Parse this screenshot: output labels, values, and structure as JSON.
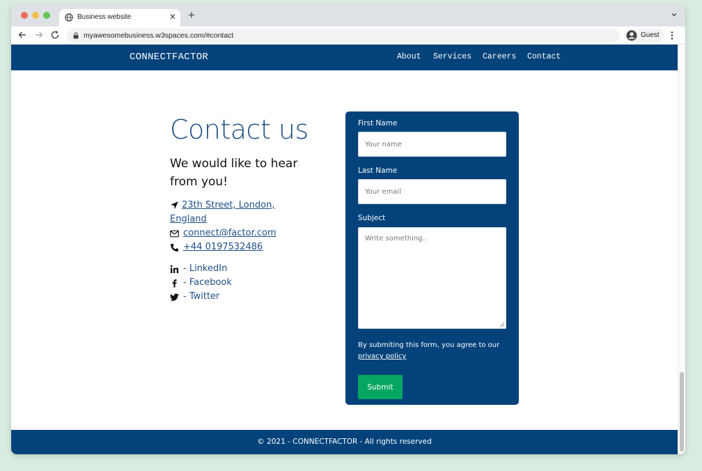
{
  "browser": {
    "tab_title": "Business website",
    "url": "myawesomebusiness.w3spaces.com/#contact",
    "profile_label": "Guest"
  },
  "navbar": {
    "brand": "CONNECTFACTOR",
    "links": [
      "About",
      "Services",
      "Careers",
      "Contact"
    ]
  },
  "contact": {
    "title": "Contact us",
    "subtitle": "We would like to hear from you!",
    "address": "23th Street, London, England",
    "email": "connect@factor.com",
    "phone": "+44 0197532486",
    "socials": [
      "- LinkedIn",
      "- Facebook",
      "- Twitter"
    ]
  },
  "form": {
    "first_name_label": "First Name",
    "first_name_placeholder": "Your name",
    "last_name_label": "Last Name",
    "last_name_placeholder": "Your email",
    "subject_label": "Subject",
    "subject_placeholder": "Write something..",
    "consent_text": "By submiting this form, you agree to our",
    "policy_link": "privacy policy",
    "submit_label": "Submit"
  },
  "footer": {
    "text": "© 2021 - CONNECTFACTOR - All rights reserved"
  },
  "colors": {
    "brand_blue": "#03427a",
    "heading_blue": "#1e4f86",
    "submit_green": "#05a661"
  }
}
